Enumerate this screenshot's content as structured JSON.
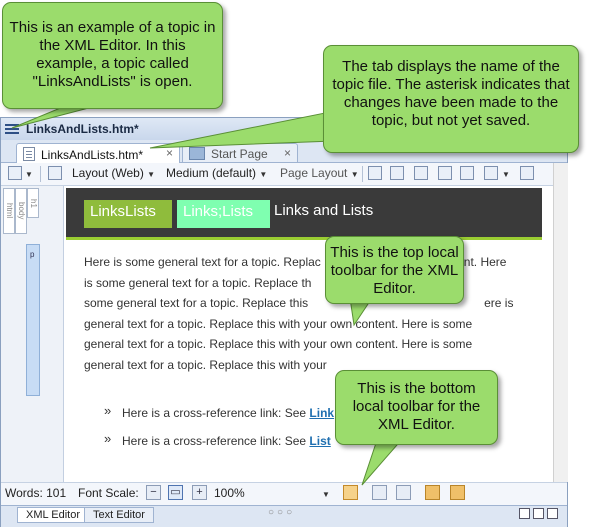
{
  "window": {
    "title": "LinksAndLists.htm*"
  },
  "tabs": [
    {
      "label": "LinksAndLists.htm*",
      "close": "×"
    },
    {
      "label": "Start Page",
      "close": "×"
    }
  ],
  "toolbar": {
    "layout": "Layout (Web)",
    "medium": "Medium (default)",
    "page_layout": "Page Layout"
  },
  "structure_bar": {
    "labels": [
      "html",
      "body",
      "h1"
    ],
    "p_label": "p"
  },
  "content": {
    "heading_label1": "LinksLists",
    "heading_label2": "Links;Lists",
    "heading_rest": "Links and Lists",
    "lines": [
      "Here is some general text for a topic. Replac",
      "is some general text for a topic. Replace th",
      "some general text for a topic. Replace this",
      "general text for a topic. Replace this with your own content. Here is some",
      "general text for a topic. Replace this with your own content. Here is some",
      "general text for a topic. Replace this with your"
    ],
    "line1_tail": "nt. Here",
    "line3_tail": "ere is",
    "bullet_symbol": "»",
    "bullets": [
      {
        "text": "Here is a cross-reference link: See",
        "link": "Link"
      },
      {
        "text": "Here is a cross-reference link: See",
        "link": "List"
      }
    ]
  },
  "bottom_toolbar": {
    "words_label": "Words: 101",
    "font_scale_label": "Font Scale:",
    "zoom": "100%"
  },
  "status_tabs": [
    "XML Editor",
    "Text Editor"
  ],
  "callouts": {
    "c1": "This is an example of a topic in the XML Editor. In this example, a topic called \"LinksAndLists\" is open.",
    "c2": "The tab displays the name of the topic file. The asterisk indicates that changes have been made to the topic, but not yet saved.",
    "c3": "This is the top local toolbar for the XML Editor.",
    "c4": "This is the bottom local toolbar for the XML Editor."
  },
  "colors": {
    "callout_fill": "#9bdc6c",
    "topic_bar": "#3a3a3a",
    "label1": "#8fbc3c",
    "label2": "#7fffb0",
    "link": "#1f6fb0"
  }
}
